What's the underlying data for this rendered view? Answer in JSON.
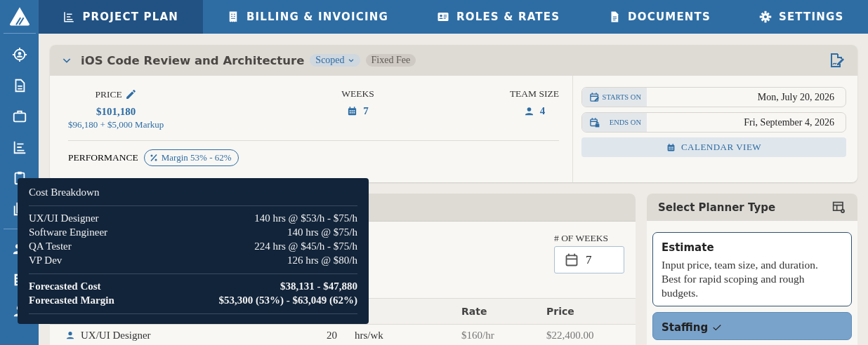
{
  "nav": {
    "tabs": [
      {
        "label": "PROJECT PLAN",
        "selected": true
      },
      {
        "label": "BILLING & INVOICING",
        "selected": false
      },
      {
        "label": "ROLES & RATES",
        "selected": false
      },
      {
        "label": "DOCUMENTS",
        "selected": false
      },
      {
        "label": "SETTINGS",
        "selected": false
      }
    ]
  },
  "project": {
    "title": "iOS Code Review and Architecture",
    "status": "Scoped",
    "fee_type": "Fixed Fee",
    "price_label": "PRICE",
    "price": "$101,180",
    "price_detail": "$96,180 + $5,000 Markup",
    "weeks_label": "WEEKS",
    "weeks": "7",
    "team_label": "TEAM SIZE",
    "team": "4",
    "performance_label": "PERFORMANCE",
    "performance": "Margin 53% - 62%",
    "starts_label": "STARTS ON",
    "starts": "Mon, July 20, 2026",
    "ends_label": "ENDS ON",
    "ends": "Fri, September 4, 2026",
    "calendar_button": "CALENDAR VIEW"
  },
  "staffing": {
    "weeks_label": "# OF WEEKS",
    "weeks": "7",
    "columns": [
      "Rate",
      "Price"
    ],
    "rows": [
      {
        "role": "UX/UI Designer",
        "hours": "20",
        "unit": "hrs/wk",
        "rate": "$160/hr",
        "price": "$22,400.00"
      }
    ]
  },
  "planner": {
    "title": "Select Planner Type",
    "options": [
      {
        "title": "Estimate",
        "description": "Input price, team size, and duration. Best for rapid scoping and rough budgets.",
        "selected": false
      },
      {
        "title": "Staffing",
        "selected": true
      }
    ]
  },
  "cost_breakdown": {
    "title": "Cost Breakdown",
    "lines": [
      {
        "role": "UX/UI Designer",
        "detail": "140 hrs @ $53/h - $75/h"
      },
      {
        "role": "Software Engineer",
        "detail": "140 hrs @ $75/h"
      },
      {
        "role": "QA Tester",
        "detail": "224 hrs @ $45/h - $75/h"
      },
      {
        "role": "VP Dev",
        "detail": "126 hrs @ $80/h"
      }
    ],
    "totals": [
      {
        "label": "Forecasted Cost",
        "value": "$38,131 - $47,880"
      },
      {
        "label": "Forecasted Margin",
        "value": "$53,300 (53%) - $63,049 (62%)"
      }
    ]
  }
}
